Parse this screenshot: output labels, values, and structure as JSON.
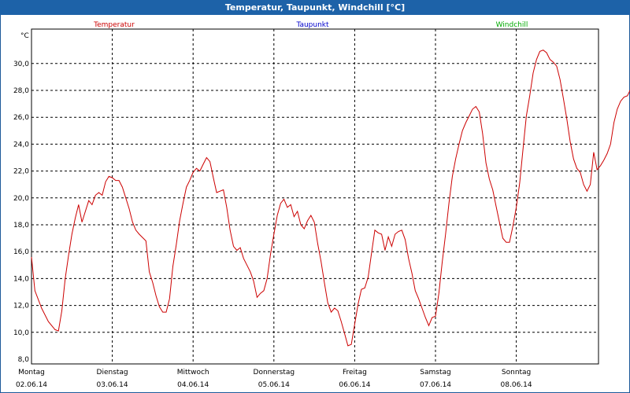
{
  "window": {
    "title": "Temperatur, Taupunkt, Windchill [°C]"
  },
  "colors": {
    "temperature": "#cc0000",
    "dewpoint": "#0000cc",
    "windchill": "#00aa00",
    "titlebar": "#1d62a8"
  },
  "chart_data": {
    "type": "line",
    "title": "Temperatur, Taupunkt, Windchill [°C]",
    "ylabel": "°C",
    "ylim": [
      8.0,
      32.0
    ],
    "yticks": [
      "8,0",
      "10,0",
      "12,0",
      "14,0",
      "16,0",
      "18,0",
      "20,0",
      "22,0",
      "24,0",
      "26,0",
      "28,0",
      "30,0"
    ],
    "grid": true,
    "legend": [
      {
        "name": "Temperatur",
        "color": "#cc0000"
      },
      {
        "name": "Taupunkt",
        "color": "#0000cc"
      },
      {
        "name": "Windchill",
        "color": "#00aa00"
      }
    ],
    "days": [
      {
        "day": "Montag",
        "date": "02.06.14"
      },
      {
        "day": "Dienstag",
        "date": "03.06.14"
      },
      {
        "day": "Mittwoch",
        "date": "04.06.14"
      },
      {
        "day": "Donnerstag",
        "date": "05.06.14"
      },
      {
        "day": "Freitag",
        "date": "06.06.14"
      },
      {
        "day": "Samstag",
        "date": "07.06.14"
      },
      {
        "day": "Sonntag",
        "date": "08.06.14"
      }
    ],
    "x_unit": "hours since 02.06.14 00:00",
    "series": [
      {
        "name": "Temperatur",
        "color": "#cc0000",
        "points": [
          [
            0,
            15.6
          ],
          [
            1,
            13.1
          ],
          [
            3,
            11.8
          ],
          [
            5,
            10.8
          ],
          [
            7,
            10.2
          ],
          [
            8,
            10.1
          ],
          [
            9,
            11.6
          ],
          [
            10,
            14.0
          ],
          [
            11,
            15.7
          ],
          [
            12,
            17.3
          ],
          [
            13,
            18.5
          ],
          [
            14,
            19.5
          ],
          [
            15,
            18.2
          ],
          [
            16,
            19.0
          ],
          [
            17,
            19.8
          ],
          [
            18,
            19.5
          ],
          [
            19,
            20.2
          ],
          [
            20,
            20.4
          ],
          [
            21,
            20.2
          ],
          [
            22,
            21.2
          ],
          [
            23,
            21.6
          ],
          [
            24,
            21.5
          ],
          [
            25,
            21.3
          ],
          [
            26,
            21.3
          ],
          [
            27,
            20.8
          ],
          [
            28,
            20.0
          ],
          [
            29,
            19.2
          ],
          [
            30,
            18.2
          ],
          [
            31,
            17.6
          ],
          [
            32,
            17.3
          ],
          [
            34,
            16.8
          ],
          [
            35,
            14.5
          ],
          [
            36,
            13.7
          ],
          [
            37,
            12.7
          ],
          [
            38,
            11.9
          ],
          [
            39,
            11.5
          ],
          [
            40,
            11.5
          ],
          [
            41,
            12.5
          ],
          [
            42,
            14.9
          ],
          [
            43,
            16.5
          ],
          [
            44,
            18.3
          ],
          [
            45,
            19.6
          ],
          [
            46,
            20.8
          ],
          [
            47,
            21.3
          ],
          [
            48,
            21.9
          ],
          [
            49,
            22.2
          ],
          [
            50,
            22.0
          ],
          [
            51,
            22.5
          ],
          [
            52,
            23.0
          ],
          [
            53,
            22.7
          ],
          [
            54,
            21.5
          ],
          [
            55,
            20.4
          ],
          [
            56,
            20.5
          ],
          [
            57,
            20.6
          ],
          [
            58,
            19.3
          ],
          [
            59,
            17.6
          ],
          [
            60,
            16.4
          ],
          [
            61,
            16.1
          ],
          [
            62,
            16.3
          ],
          [
            63,
            15.5
          ],
          [
            64,
            15.0
          ],
          [
            65,
            14.5
          ],
          [
            66,
            13.8
          ],
          [
            67,
            12.6
          ],
          [
            68,
            12.9
          ],
          [
            69,
            13.1
          ],
          [
            70,
            14.0
          ],
          [
            71,
            15.8
          ],
          [
            72,
            17.3
          ],
          [
            73,
            18.7
          ],
          [
            74,
            19.6
          ],
          [
            75,
            19.9
          ],
          [
            76,
            19.3
          ],
          [
            77,
            19.5
          ],
          [
            78,
            18.6
          ],
          [
            79,
            19.0
          ],
          [
            80,
            18.0
          ],
          [
            81,
            17.7
          ],
          [
            82,
            18.3
          ],
          [
            83,
            18.7
          ],
          [
            84,
            18.2
          ],
          [
            85,
            16.6
          ],
          [
            86,
            15.3
          ],
          [
            87,
            13.7
          ],
          [
            88,
            12.2
          ],
          [
            89,
            11.5
          ],
          [
            90,
            11.8
          ],
          [
            91,
            11.6
          ],
          [
            92,
            10.8
          ],
          [
            93,
            9.9
          ],
          [
            94,
            9.0
          ],
          [
            95,
            9.1
          ],
          [
            96,
            10.6
          ],
          [
            97,
            12.1
          ],
          [
            98,
            13.2
          ],
          [
            99,
            13.3
          ],
          [
            100,
            14.1
          ],
          [
            101,
            15.9
          ],
          [
            102,
            17.6
          ],
          [
            103,
            17.4
          ],
          [
            104,
            17.3
          ],
          [
            105,
            16.1
          ],
          [
            106,
            17.1
          ],
          [
            107,
            16.4
          ],
          [
            108,
            17.3
          ],
          [
            109,
            17.5
          ],
          [
            110,
            17.6
          ],
          [
            111,
            16.9
          ],
          [
            112,
            15.5
          ],
          [
            113,
            14.4
          ],
          [
            114,
            13.1
          ],
          [
            115,
            12.5
          ],
          [
            116,
            11.8
          ],
          [
            117,
            11.1
          ],
          [
            118,
            10.5
          ],
          [
            119,
            11.1
          ],
          [
            120,
            11.2
          ],
          [
            121,
            12.9
          ],
          [
            122,
            15.2
          ],
          [
            123,
            17.3
          ],
          [
            124,
            19.6
          ],
          [
            125,
            21.6
          ],
          [
            126,
            22.9
          ],
          [
            127,
            24.0
          ],
          [
            128,
            25.0
          ],
          [
            129,
            25.6
          ],
          [
            130,
            26.1
          ],
          [
            131,
            26.6
          ],
          [
            132,
            26.8
          ],
          [
            133,
            26.4
          ],
          [
            134,
            24.8
          ],
          [
            135,
            22.6
          ],
          [
            136,
            21.4
          ],
          [
            137,
            20.6
          ],
          [
            138,
            19.4
          ],
          [
            139,
            18.2
          ],
          [
            140,
            17.0
          ],
          [
            141,
            16.7
          ],
          [
            142,
            16.7
          ],
          [
            143,
            17.9
          ],
          [
            144,
            19.3
          ],
          [
            145,
            21.1
          ],
          [
            146,
            23.6
          ],
          [
            147,
            26.1
          ],
          [
            148,
            27.6
          ],
          [
            149,
            29.3
          ],
          [
            150,
            30.3
          ],
          [
            151,
            30.9
          ],
          [
            152,
            31.0
          ],
          [
            153,
            30.8
          ],
          [
            154,
            30.3
          ],
          [
            155,
            30.1
          ],
          [
            156,
            29.8
          ],
          [
            157,
            28.8
          ],
          [
            158,
            27.4
          ],
          [
            159,
            25.9
          ],
          [
            160,
            24.2
          ],
          [
            161,
            22.9
          ],
          [
            162,
            22.2
          ],
          [
            163,
            21.9
          ],
          [
            164,
            21.0
          ],
          [
            165,
            20.5
          ],
          [
            166,
            21.0
          ],
          [
            167,
            23.4
          ],
          [
            168,
            22.1
          ],
          [
            169,
            22.4
          ],
          [
            170,
            22.8
          ],
          [
            171,
            23.3
          ],
          [
            172,
            24.0
          ],
          [
            173,
            25.6
          ],
          [
            174,
            26.6
          ],
          [
            175,
            27.2
          ],
          [
            176,
            27.5
          ],
          [
            177,
            27.6
          ],
          [
            178,
            28.1
          ],
          [
            179,
            27.9
          ],
          [
            180,
            26.3
          ],
          [
            181,
            24.6
          ],
          [
            182,
            23.3
          ]
        ]
      }
    ]
  }
}
